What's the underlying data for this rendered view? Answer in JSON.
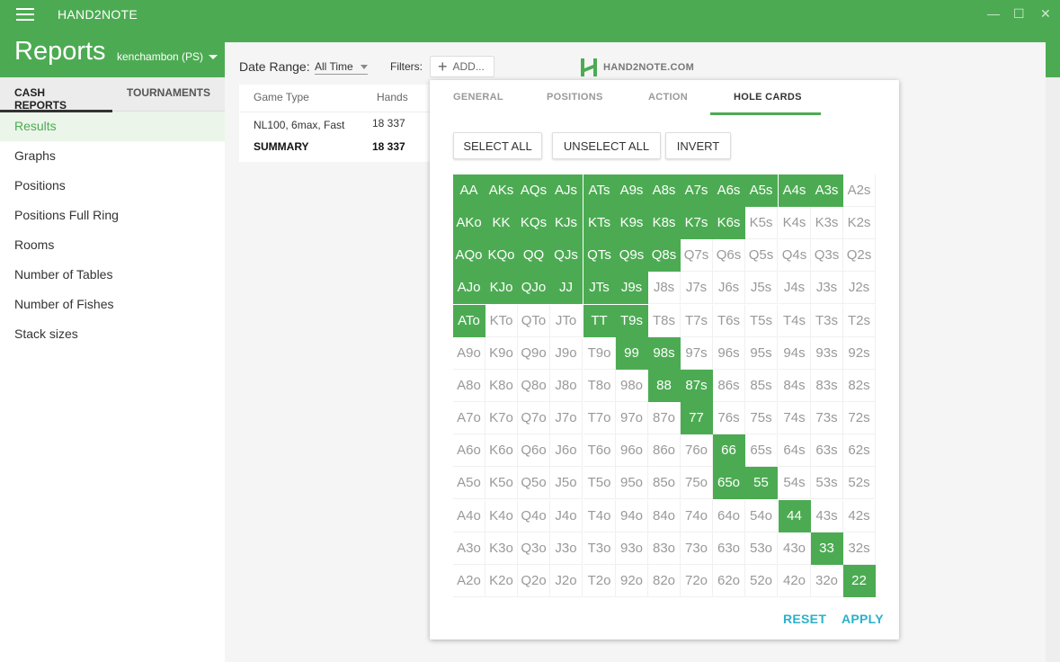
{
  "app": {
    "title": "HAND2NOTE",
    "window_controls": {
      "minimize": "—",
      "maximize": "☐",
      "close": "✕"
    }
  },
  "header": {
    "title": "Reports",
    "account": "kenchambon (PS)"
  },
  "sidebar": {
    "tabs": [
      {
        "label": "CASH REPORTS",
        "active": true
      },
      {
        "label": "TOURNAMENTS",
        "active": false
      }
    ],
    "items": [
      {
        "label": "Results",
        "active": true
      },
      {
        "label": "Graphs"
      },
      {
        "label": "Positions"
      },
      {
        "label": "Positions Full Ring"
      },
      {
        "label": "Rooms"
      },
      {
        "label": "Number of Tables"
      },
      {
        "label": "Number of Fishes"
      },
      {
        "label": "Stack sizes"
      }
    ]
  },
  "toolbar": {
    "date_range_label": "Date Range:",
    "date_range_value": "All Time",
    "filters_label": "Filters:",
    "add_label": "ADD...",
    "logo_text": "HAND2NOTE.COM"
  },
  "table": {
    "headers": {
      "game_type": "Game Type",
      "hands": "Hands"
    },
    "rows": [
      {
        "game_type": "NL100, 6max, Fast",
        "hands": "18 337"
      }
    ],
    "summary": {
      "label": "SUMMARY",
      "hands": "18 337"
    }
  },
  "filter_popup": {
    "tabs": [
      {
        "label": "GENERAL"
      },
      {
        "label": "POSITIONS"
      },
      {
        "label": "ACTION"
      },
      {
        "label": "HOLE CARDS",
        "active": true
      }
    ],
    "buttons": {
      "select_all": "SELECT ALL",
      "unselect_all": "UNSELECT ALL",
      "invert": "INVERT"
    },
    "reset": "RESET",
    "apply": "APPLY",
    "grid": [
      [
        "AA",
        "AKs",
        "AQs",
        "AJs",
        "ATs",
        "A9s",
        "A8s",
        "A7s",
        "A6s",
        "A5s",
        "A4s",
        "A3s",
        "A2s"
      ],
      [
        "AKo",
        "KK",
        "KQs",
        "KJs",
        "KTs",
        "K9s",
        "K8s",
        "K7s",
        "K6s",
        "K5s",
        "K4s",
        "K3s",
        "K2s"
      ],
      [
        "AQo",
        "KQo",
        "QQ",
        "QJs",
        "QTs",
        "Q9s",
        "Q8s",
        "Q7s",
        "Q6s",
        "Q5s",
        "Q4s",
        "Q3s",
        "Q2s"
      ],
      [
        "AJo",
        "KJo",
        "QJo",
        "JJ",
        "JTs",
        "J9s",
        "J8s",
        "J7s",
        "J6s",
        "J5s",
        "J4s",
        "J3s",
        "J2s"
      ],
      [
        "ATo",
        "KTo",
        "QTo",
        "JTo",
        "TT",
        "T9s",
        "T8s",
        "T7s",
        "T6s",
        "T5s",
        "T4s",
        "T3s",
        "T2s"
      ],
      [
        "A9o",
        "K9o",
        "Q9o",
        "J9o",
        "T9o",
        "99",
        "98s",
        "97s",
        "96s",
        "95s",
        "94s",
        "93s",
        "92s"
      ],
      [
        "A8o",
        "K8o",
        "Q8o",
        "J8o",
        "T8o",
        "98o",
        "88",
        "87s",
        "86s",
        "85s",
        "84s",
        "83s",
        "82s"
      ],
      [
        "A7o",
        "K7o",
        "Q7o",
        "J7o",
        "T7o",
        "97o",
        "87o",
        "77",
        "76s",
        "75s",
        "74s",
        "73s",
        "72s"
      ],
      [
        "A6o",
        "K6o",
        "Q6o",
        "J6o",
        "T6o",
        "96o",
        "86o",
        "76o",
        "66",
        "65s",
        "64s",
        "63s",
        "62s"
      ],
      [
        "A5o",
        "K5o",
        "Q5o",
        "J5o",
        "T5o",
        "95o",
        "85o",
        "75o",
        "65o",
        "55",
        "54s",
        "53s",
        "52s"
      ],
      [
        "A4o",
        "K4o",
        "Q4o",
        "J4o",
        "T4o",
        "94o",
        "84o",
        "74o",
        "64o",
        "54o",
        "44",
        "43s",
        "42s"
      ],
      [
        "A3o",
        "K3o",
        "Q3o",
        "J3o",
        "T3o",
        "93o",
        "83o",
        "73o",
        "63o",
        "53o",
        "43o",
        "33",
        "32s"
      ],
      [
        "A2o",
        "K2o",
        "Q2o",
        "J2o",
        "T2o",
        "92o",
        "82o",
        "72o",
        "62o",
        "52o",
        "42o",
        "32o",
        "22"
      ]
    ],
    "selected": [
      [
        0,
        1,
        2,
        3,
        4,
        5,
        6,
        7,
        8,
        9,
        10,
        11
      ],
      [
        0,
        1,
        2,
        3,
        4,
        5,
        6,
        7,
        8
      ],
      [
        0,
        1,
        2,
        3,
        4,
        5,
        6
      ],
      [
        0,
        1,
        2,
        3,
        4,
        5
      ],
      [
        0,
        4,
        5
      ],
      [
        5,
        6
      ],
      [
        6,
        7
      ],
      [
        7
      ],
      [
        8
      ],
      [
        8,
        9
      ],
      [
        10
      ],
      [
        11
      ],
      [
        12
      ]
    ]
  },
  "colors": {
    "brand_green": "#4cab52",
    "link_cyan": "#2bb1c9"
  }
}
